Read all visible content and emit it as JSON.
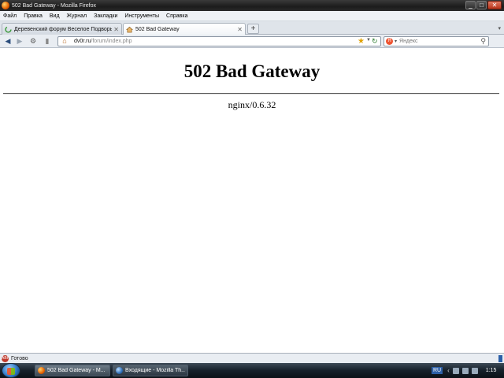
{
  "window": {
    "title": "502 Bad Gateway - Mozilla Firefox"
  },
  "menu": [
    "Файл",
    "Правка",
    "Вид",
    "Журнал",
    "Закладки",
    "Инструменты",
    "Справка"
  ],
  "tabs": [
    {
      "label": "Деревенский форум Веселое Подворь..."
    },
    {
      "label": "502 Bad Gateway"
    }
  ],
  "nav": {
    "url_host": "dv0r.ru",
    "url_path": "/forum/index.php",
    "search_placeholder": "Яндекс"
  },
  "page": {
    "heading": "502 Bad Gateway",
    "server_name": "nginx",
    "server_version": "/0.6.32"
  },
  "status": {
    "text": "Готово"
  },
  "taskbar": {
    "buttons": [
      {
        "label": "502 Bad Gateway - M..."
      },
      {
        "label": "Входящие - Mozilla Th..."
      }
    ],
    "lang": "RU",
    "clock": "1:15"
  },
  "colors": {
    "accent": "#2b5fa8",
    "firefox": "#e66000"
  }
}
